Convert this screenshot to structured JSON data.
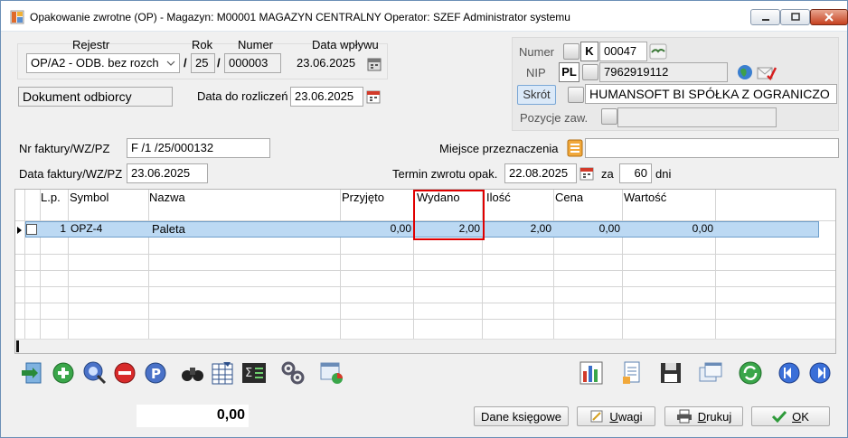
{
  "window": {
    "title": "Opakowanie zwrotne (OP) - Magazyn: M00001 MAGAZYN CENTRALNY  Operator: SZEF Administrator systemu"
  },
  "header": {
    "rejestr_label": "Rejestr",
    "rok_label": "Rok",
    "numer_label": "Numer",
    "data_wplywu_label": "Data wpływu",
    "rejestr_value": "OP/A2  - ODB. bez rozch",
    "separator": "/",
    "rok_value": "25",
    "numer_value": "000003",
    "data_wplywu_value": "23.06.2025",
    "doc_type": "Dokument odbiorcy",
    "data_rozliczen_label": "Data do rozliczeń",
    "data_rozliczen_value": "23.06.2025",
    "nr_faktury_label": "Nr faktury/WZ/PZ",
    "nr_faktury_value": "F /1  /25/000132",
    "data_faktury_label": "Data faktury/WZ/PZ",
    "data_faktury_value": "23.06.2025",
    "miejsce_label": "Miejsce przeznaczenia",
    "miejsce_value": "",
    "termin_label": "Termin zwrotu opak.",
    "termin_value": "22.08.2025",
    "za_label": "za",
    "dni_value": "60",
    "dni_label": "dni"
  },
  "contractor": {
    "numer_label": "Numer",
    "k_badge": "K",
    "numer_value": "00047",
    "nip_label": "NIP",
    "pl_badge": "PL",
    "nip_value": "7962919112",
    "skrot_label": "Skrót",
    "skrot_value": "HUMANSOFT BI SPÓŁKA Z OGRANICZO",
    "pozycje_label": "Pozycje zaw.",
    "pozycje_value": ""
  },
  "grid": {
    "headers": {
      "lp": "L.p.",
      "symbol": "Symbol",
      "nazwa": "Nazwa",
      "przyjeto": "Przyjęto",
      "wydano": "Wydano",
      "ilosc": "Ilość",
      "cena": "Cena",
      "wartosc": "Wartość"
    },
    "rows": [
      {
        "lp": "1",
        "symbol": "OPZ-4",
        "nazwa": "Paleta",
        "przyjeto": "0,00",
        "wydano": "2,00",
        "ilosc": "2,00",
        "cena": "0,00",
        "wartosc": "0,00"
      }
    ]
  },
  "footer": {
    "sum": "0,00",
    "dane_ksiegowe": "Dane księgowe",
    "uwagi_u": "U",
    "uwagi_rest": "wagi",
    "drukuj_u": "D",
    "drukuj_rest": "rukuj",
    "ok_u": "O",
    "ok_rest": "K"
  },
  "colors": {
    "selected_row": "#bcd9f3",
    "highlight": "#e00000"
  }
}
